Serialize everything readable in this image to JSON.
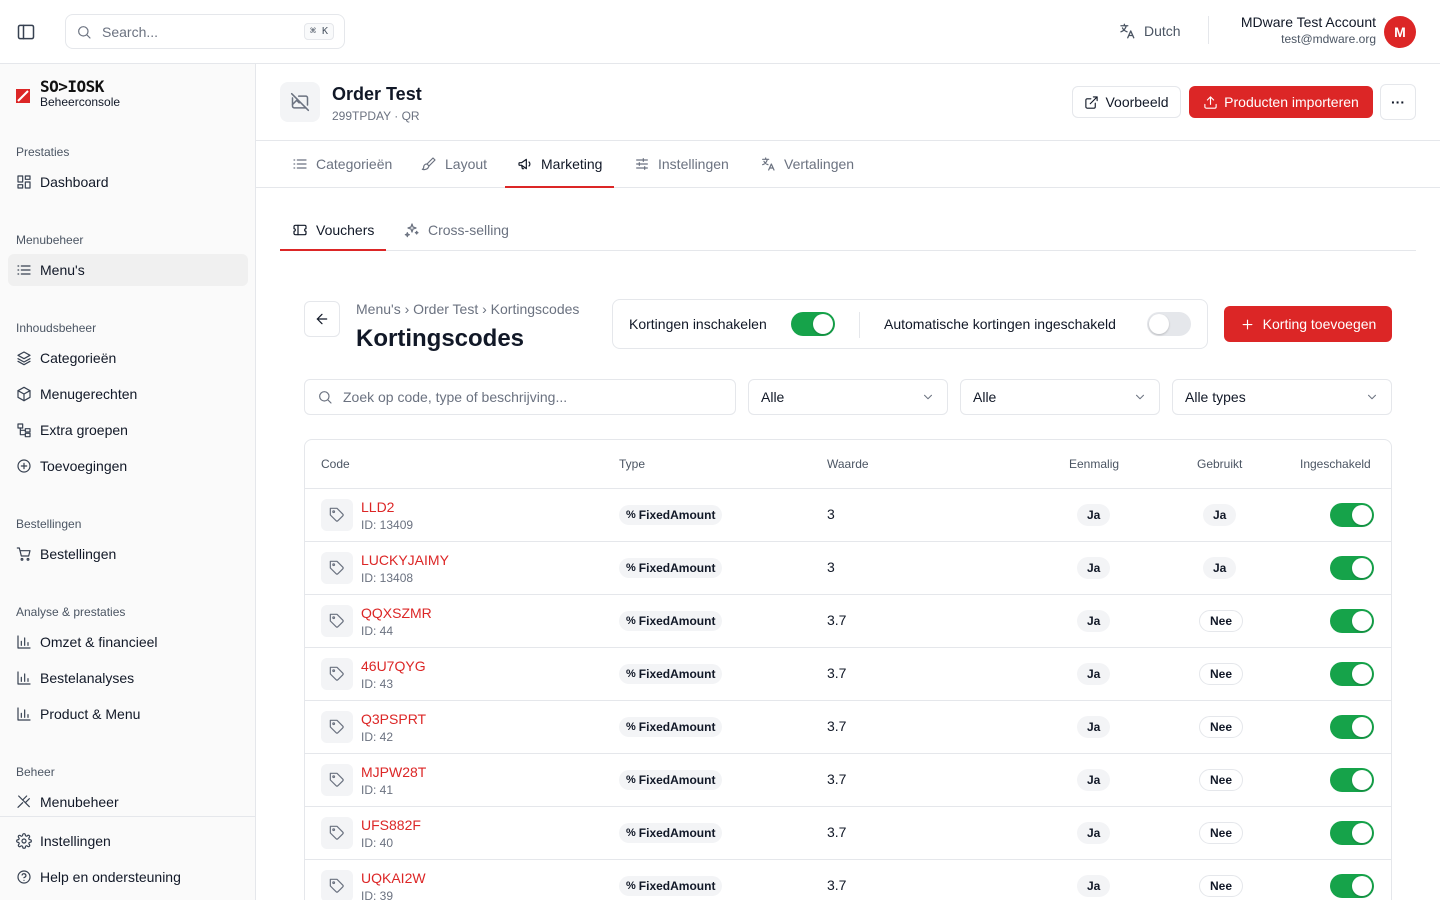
{
  "topbar": {
    "search_placeholder": "Search...",
    "search_shortcut": "⌘ K",
    "language": "Dutch",
    "account_name": "MDware Test Account",
    "account_email": "test@mdware.org",
    "avatar_initial": "M"
  },
  "sidebar": {
    "logo_text": "SO>IOSK",
    "logo_sub": "Beheerconsole",
    "groups": [
      {
        "heading": "Prestaties",
        "items": [
          {
            "label": "Dashboard",
            "icon": "dashboard-icon"
          }
        ]
      },
      {
        "heading": "Menubeheer",
        "items": [
          {
            "label": "Menu's",
            "icon": "list-icon",
            "active": true
          }
        ]
      },
      {
        "heading": "Inhoudsbeheer",
        "items": [
          {
            "label": "Categorieën",
            "icon": "layers-icon"
          },
          {
            "label": "Menugerechten",
            "icon": "box-icon"
          },
          {
            "label": "Extra groepen",
            "icon": "tree-icon"
          },
          {
            "label": "Toevoegingen",
            "icon": "plus-circle-icon"
          }
        ]
      },
      {
        "heading": "Bestellingen",
        "items": [
          {
            "label": "Bestellingen",
            "icon": "cart-icon"
          }
        ]
      },
      {
        "heading": "Analyse & prestaties",
        "items": [
          {
            "label": "Omzet & financieel",
            "icon": "bar-chart-icon"
          },
          {
            "label": "Bestelanalyses",
            "icon": "bar-chart-icon"
          },
          {
            "label": "Product & Menu",
            "icon": "bar-chart-icon"
          }
        ]
      },
      {
        "heading": "Beheer",
        "items": [
          {
            "label": "Menubeheer",
            "icon": "utensils-icon"
          }
        ]
      }
    ],
    "bottom": [
      {
        "label": "Instellingen",
        "icon": "gear-icon"
      },
      {
        "label": "Help en ondersteuning",
        "icon": "help-icon"
      }
    ]
  },
  "header": {
    "title": "Order Test",
    "subtitle": "299TPDAY · QR",
    "preview_label": "Voorbeeld",
    "import_label": "Producten importeren",
    "more_label": "···"
  },
  "tabs": [
    "Categorieën",
    "Layout",
    "Marketing",
    "Instellingen",
    "Vertalingen"
  ],
  "active_tab": "Marketing",
  "subtabs": [
    "Vouchers",
    "Cross-selling"
  ],
  "active_subtab": "Vouchers",
  "content": {
    "breadcrumb": "Menu's › Order Test › Kortingscodes",
    "title": "Kortingscodes",
    "toggle1_label": "Kortingen inschakelen",
    "toggle1_on": true,
    "toggle2_label": "Automatische kortingen ingeschakeld",
    "toggle2_on": false,
    "add_button": "Korting toevoegen",
    "filter_placeholder": "Zoek op code, type of beschrijving...",
    "filter1": "Alle",
    "filter2": "Alle",
    "filter3": "Alle types"
  },
  "table": {
    "columns": [
      "Code",
      "Type",
      "Waarde",
      "Eenmalig",
      "Gebruikt",
      "Ingeschakeld"
    ],
    "rows": [
      {
        "code": "LLD2",
        "id": "ID: 13409",
        "type": "FixedAmount",
        "value": "3",
        "once": "Ja",
        "used": "Ja",
        "enabled": true
      },
      {
        "code": "LUCKYJAIMY",
        "id": "ID: 13408",
        "type": "FixedAmount",
        "value": "3",
        "once": "Ja",
        "used": "Ja",
        "enabled": true
      },
      {
        "code": "QQXSZMR",
        "id": "ID: 44",
        "type": "FixedAmount",
        "value": "3.7",
        "once": "Ja",
        "used": "Nee",
        "enabled": true
      },
      {
        "code": "46U7QYG",
        "id": "ID: 43",
        "type": "FixedAmount",
        "value": "3.7",
        "once": "Ja",
        "used": "Nee",
        "enabled": true
      },
      {
        "code": "Q3PSPRT",
        "id": "ID: 42",
        "type": "FixedAmount",
        "value": "3.7",
        "once": "Ja",
        "used": "Nee",
        "enabled": true
      },
      {
        "code": "MJPW28T",
        "id": "ID: 41",
        "type": "FixedAmount",
        "value": "3.7",
        "once": "Ja",
        "used": "Nee",
        "enabled": true
      },
      {
        "code": "UFS882F",
        "id": "ID: 40",
        "type": "FixedAmount",
        "value": "3.7",
        "once": "Ja",
        "used": "Nee",
        "enabled": true
      },
      {
        "code": "UQKAI2W",
        "id": "ID: 39",
        "type": "FixedAmount",
        "value": "3.7",
        "once": "Ja",
        "used": "Nee",
        "enabled": true
      }
    ]
  },
  "colors": {
    "accent": "#dc2626",
    "toggle_on": "#16a34a"
  }
}
